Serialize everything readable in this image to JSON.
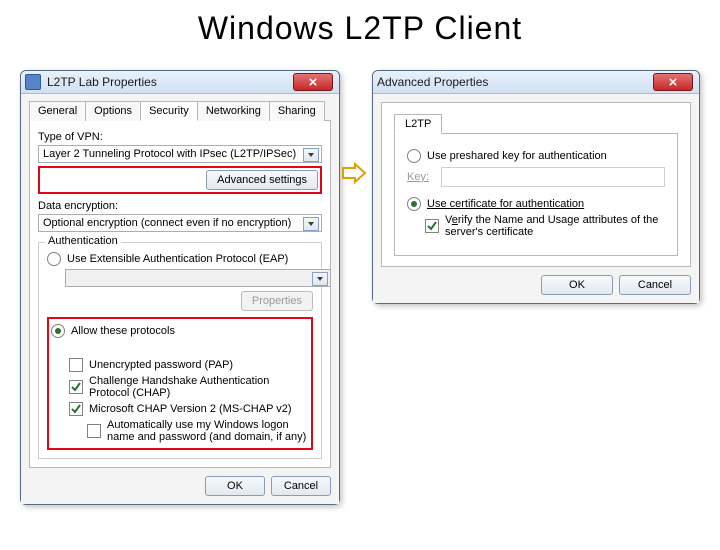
{
  "page": {
    "title": "Windows L2TP Client"
  },
  "win1": {
    "title": "L2TP Lab Properties",
    "tabs": [
      "General",
      "Options",
      "Security",
      "Networking",
      "Sharing"
    ],
    "active_tab": 2,
    "type_of_vpn_label": "Type of VPN:",
    "vpn_value": "Layer 2 Tunneling Protocol with IPsec (L2TP/IPSec)",
    "advanced_btn": "Advanced settings",
    "data_enc_label": "Data encryption:",
    "data_enc_value": "Optional encryption (connect even if no encryption)",
    "auth_legend": "Authentication",
    "eap_label": "Use Extensible Authentication Protocol (EAP)",
    "properties_btn": "Properties",
    "allow_label": "Allow these protocols",
    "pap_label": "Unencrypted password (PAP)",
    "chap_label": "Challenge Handshake Authentication Protocol (CHAP)",
    "mschap_label": "Microsoft CHAP Version 2 (MS-CHAP v2)",
    "autologon_label": "Automatically use my Windows logon name and password (and domain, if any)",
    "ok": "OK",
    "cancel": "Cancel"
  },
  "win2": {
    "title": "Advanced Properties",
    "tab": "L2TP",
    "psk_label": "Use preshared key for authentication",
    "key_label_pre": "K",
    "key_label_under": "e",
    "key_label_post": "y:",
    "cert_label": "Use certificate for authentication",
    "verify_pre": "V",
    "verify_under": "e",
    "verify_post": "rify the Name and Usage attributes of the server's certificate",
    "ok": "OK",
    "cancel": "Cancel"
  }
}
